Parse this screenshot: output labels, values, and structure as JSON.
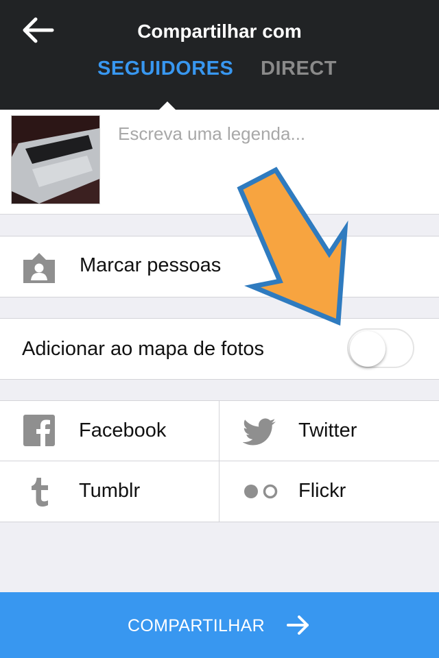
{
  "header": {
    "title": "Compartilhar com",
    "tabs": [
      {
        "label": "SEGUIDORES",
        "active": true
      },
      {
        "label": "DIRECT",
        "active": false
      }
    ]
  },
  "caption": {
    "placeholder": "Escreva uma legenda..."
  },
  "tag_people": {
    "label": "Marcar pessoas"
  },
  "photo_map": {
    "label": "Adicionar ao mapa de fotos",
    "enabled": false
  },
  "share_services": [
    {
      "label": "Facebook",
      "icon": "facebook-icon"
    },
    {
      "label": "Twitter",
      "icon": "twitter-icon"
    },
    {
      "label": "Tumblr",
      "icon": "tumblr-icon"
    },
    {
      "label": "Flickr",
      "icon": "flickr-icon"
    }
  ],
  "share_button": {
    "label": "COMPARTILHAR"
  },
  "colors": {
    "header_bg": "#212325",
    "accent": "#3897f0",
    "inactive_tab": "#8a8a8a",
    "background": "#efeff4",
    "annotation_arrow_fill": "#f7a440",
    "annotation_arrow_stroke": "#2f7bbf"
  }
}
